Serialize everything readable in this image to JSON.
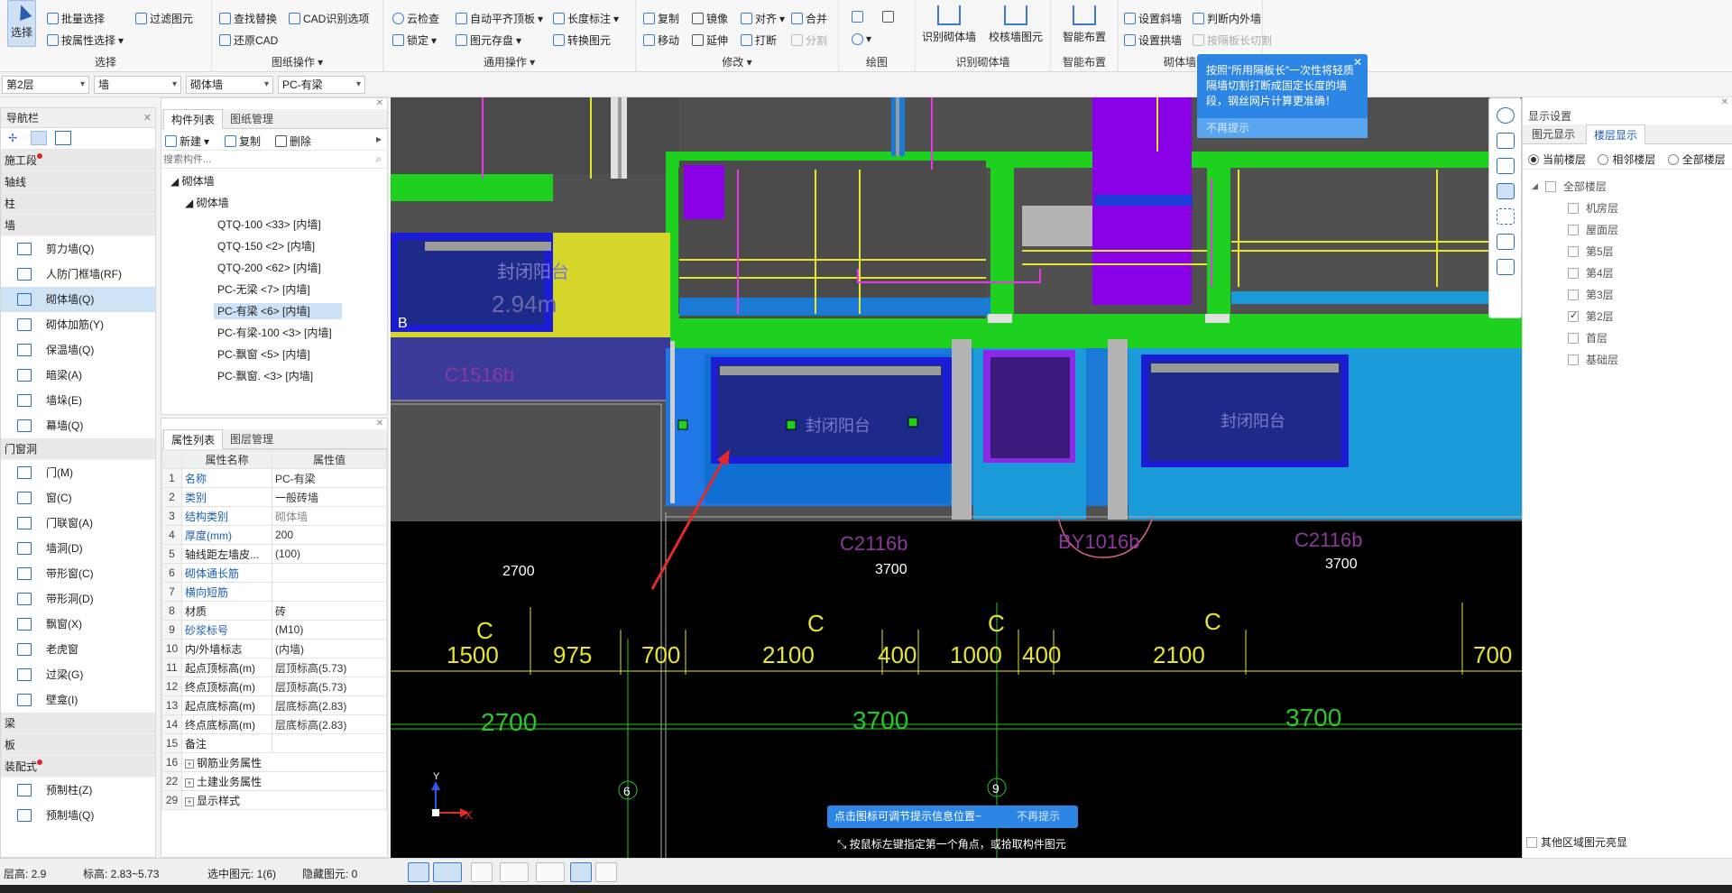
{
  "ribbon": {
    "select_label": "选择",
    "select_group": {
      "batch": "批量选择",
      "by_attr": "按属性选择",
      "filter": "过滤图元",
      "title": "选择"
    },
    "drawing_ops": {
      "find_replace": "查找替换",
      "cad_options": "CAD识别选项",
      "restore_cad": "还原CAD",
      "title": "图纸操作"
    },
    "common_ops": {
      "cloud_check": "云检查",
      "auto_align": "自动平齐顶板",
      "length_mark": "长度标注",
      "lock": "锁定",
      "elem_save": "图元存盘",
      "convert_elem": "转换图元",
      "title": "通用操作"
    },
    "modify": {
      "copy": "复制",
      "mirror": "镜像",
      "align": "对齐",
      "merge": "合并",
      "move": "移动",
      "extend": "延伸",
      "break": "打断",
      "split": "分割",
      "title": "修改"
    },
    "draw": {
      "title": "绘图"
    },
    "recognize": {
      "identify_wall": "识别砌体墙",
      "verify_wall": "校核墙图元",
      "title": "识别砌体墙"
    },
    "smart": {
      "smart_layout": "智能布置",
      "title": "智能布置"
    },
    "masonry": {
      "set_slant": "设置斜墙",
      "set_arch": "设置拱墙",
      "judge_inout": "判断内外墙",
      "by_panel": "按隔板长切割",
      "title": "砌体墙"
    }
  },
  "toolbar": {
    "floor": "第2层",
    "type": "墙",
    "subtype": "砌体墙",
    "component": "PC-有梁"
  },
  "nav": {
    "title": "导航栏",
    "categories": {
      "construction": "施工段",
      "axis": "轴线",
      "column": "柱",
      "wall": "墙",
      "opening": "门窗洞",
      "beam": "梁",
      "slab": "板",
      "prefab": "装配式"
    },
    "wall_items": [
      "剪力墙(Q)",
      "人防门框墙(RF)",
      "砌体墙(Q)",
      "砌体加筋(Y)",
      "保温墙(Q)",
      "暗梁(A)",
      "墙垛(E)",
      "幕墙(Q)"
    ],
    "opening_items": [
      "门(M)",
      "窗(C)",
      "门联窗(A)",
      "墙洞(D)",
      "带形窗(C)",
      "带形洞(D)",
      "飘窗(X)",
      "老虎窗",
      "过梁(G)",
      "壁龛(I)"
    ],
    "prefab_items": [
      "预制柱(Z)",
      "预制墙(Q)"
    ]
  },
  "components": {
    "tab1": "构件列表",
    "tab2": "图纸管理",
    "new": "新建",
    "copy": "复制",
    "delete": "删除",
    "search_placeholder": "搜索构件...",
    "root": "砌体墙",
    "group": "砌体墙",
    "items": [
      "QTQ-100 <33> [内墙]",
      "QTQ-150 <2> [内墙]",
      "QTQ-200 <62> [内墙]",
      "PC-无梁 <7> [内墙]",
      "PC-有梁 <6> [内墙]",
      "PC-有梁-100 <3> [内墙]",
      "PC-飘窗 <5> [内墙]",
      "PC-飘窗. <3> [内墙]"
    ]
  },
  "properties": {
    "tab1": "属性列表",
    "tab2": "图层管理",
    "col_name": "属性名称",
    "col_value": "属性值",
    "rows": [
      {
        "n": "1",
        "k": "名称",
        "v": "PC-有梁"
      },
      {
        "n": "2",
        "k": "类别",
        "v": "一般砖墙"
      },
      {
        "n": "3",
        "k": "结构类别",
        "v": "砌体墙"
      },
      {
        "n": "4",
        "k": "厚度(mm)",
        "v": "200"
      },
      {
        "n": "5",
        "k": "轴线距左墙皮...",
        "v": "(100)"
      },
      {
        "n": "6",
        "k": "砌体通长筋",
        "v": ""
      },
      {
        "n": "7",
        "k": "横向短筋",
        "v": ""
      },
      {
        "n": "8",
        "k": "材质",
        "v": "砖"
      },
      {
        "n": "9",
        "k": "砂浆标号",
        "v": "(M10)"
      },
      {
        "n": "10",
        "k": "内/外墙标志",
        "v": "(内墙)"
      },
      {
        "n": "11",
        "k": "起点顶标高(m)",
        "v": "层顶标高(5.73)"
      },
      {
        "n": "12",
        "k": "终点顶标高(m)",
        "v": "层顶标高(5.73)"
      },
      {
        "n": "13",
        "k": "起点底标高(m)",
        "v": "层底标高(2.83)"
      },
      {
        "n": "14",
        "k": "终点底标高(m)",
        "v": "层底标高(2.83)"
      },
      {
        "n": "15",
        "k": "备注",
        "v": ""
      },
      {
        "n": "16",
        "k": "钢筋业务属性",
        "v": ""
      },
      {
        "n": "22",
        "k": "土建业务属性",
        "v": ""
      },
      {
        "n": "29",
        "k": "显示样式",
        "v": ""
      }
    ]
  },
  "canvas": {
    "labels": {
      "balcony1": "封闭阳台",
      "area1": "2.94m",
      "b_mark": "B",
      "c1516": "C1516b",
      "balcony2": "封闭阳台",
      "balcony3": "封闭阳台",
      "c2116a": "C2116b",
      "by1016": "BY1016b",
      "c2116b": "C2116b",
      "dim2700a": "2700",
      "dim3700a": "3700",
      "dim3700b": "3700",
      "d1500": "1500",
      "d975": "975",
      "d700a": "700",
      "d2100a": "2100",
      "d400a": "400",
      "d1000": "1000",
      "d400b": "400",
      "d2100b": "2100",
      "d700b": "700",
      "c1": "C",
      "c2": "C",
      "c3": "C",
      "c4": "C",
      "g2700": "2700",
      "g3700a": "3700",
      "g3700b": "3700",
      "axis6": "6",
      "axis9": "9",
      "xaxis": "X",
      "yaxis": "Y"
    }
  },
  "popup": {
    "text": "按照“所用隔板长”一次性将轻质隔墙切割打断成固定长度的墙段，钢丝网片计算更准确！",
    "dismiss": "不再提示"
  },
  "hint": {
    "text": "点击图标可调节提示信息位置~",
    "dismiss": "不再提示"
  },
  "command": "按鼠标左键指定第一个角点，或拾取构件图元",
  "display": {
    "title": "显示设置",
    "tab1": "图元显示",
    "tab2": "楼层显示",
    "opt_current": "当前楼层",
    "opt_adjacent": "相邻楼层",
    "opt_all": "全部楼层",
    "all_floors": "全部楼层",
    "floors": [
      {
        "name": "机房层",
        "checked": false
      },
      {
        "name": "屋面层",
        "checked": false
      },
      {
        "name": "第5层",
        "checked": false
      },
      {
        "name": "第4层",
        "checked": false
      },
      {
        "name": "第3层",
        "checked": false
      },
      {
        "name": "第2层",
        "checked": true
      },
      {
        "name": "首层",
        "checked": false
      },
      {
        "name": "基础层",
        "checked": false
      }
    ],
    "other_region": "其他区域图元亮显"
  },
  "status": {
    "floor_h": "层高:  2.9",
    "elev": "标高:  2.83~5.73",
    "selected": "选中图元: 1(6)",
    "hidden": "隐藏图元:  0"
  }
}
